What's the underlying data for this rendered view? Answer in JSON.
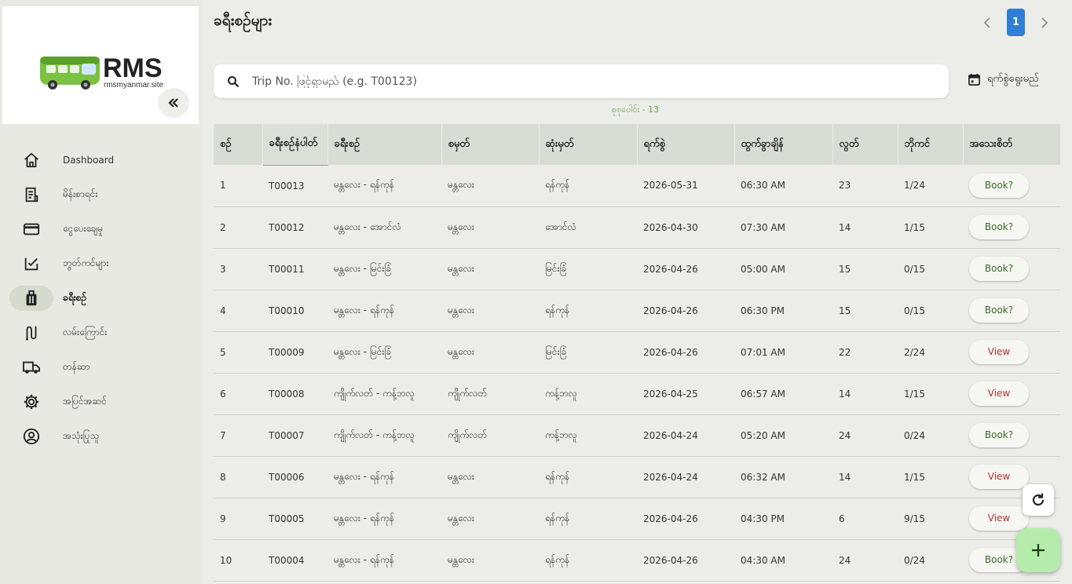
{
  "brand": {
    "logo_text": "RMS",
    "logo_subtext": "rmsmyanmar.site"
  },
  "sidebar": {
    "items": [
      {
        "label": "Dashboard",
        "icon": "home-icon"
      },
      {
        "label": "မိန်းစာရင်း",
        "icon": "receipt-icon"
      },
      {
        "label": "ငွေပေးချေမှု",
        "icon": "credit-card-icon"
      },
      {
        "label": "ဘွတ်ကင်များ",
        "icon": "checklist-icon"
      },
      {
        "label": "ခရီးစဉ်",
        "icon": "luggage-icon",
        "active": true
      },
      {
        "label": "လမ်းကြောင်း",
        "icon": "route-icon"
      },
      {
        "label": "တန်ဆာ",
        "icon": "truck-icon"
      },
      {
        "label": "အပြင်အဆင်",
        "icon": "gear-icon"
      },
      {
        "label": "အသုံးပြုသူ",
        "icon": "user-icon"
      }
    ]
  },
  "header": {
    "title": "ခရီးစဉ်များ"
  },
  "pagination": {
    "current": "1"
  },
  "search": {
    "placeholder": "Trip No. ဖြင့်ရှာမည် (e.g. T00123)",
    "value": ""
  },
  "date_filter": {
    "label": "ရက်စွဲရွေးမည်",
    "icon": "calendar-icon"
  },
  "summary": {
    "count_text": "စုစုပေါင်း - 13"
  },
  "colors": {
    "accent": "#2f7fd6",
    "fab": "#b5ecab",
    "book_text": "#3a6b2a",
    "view_text": "#b63232"
  },
  "table": {
    "columns": [
      "စဉ်",
      "ခရီးစဉ်နံပါတ်",
      "ခရီးစဉ်",
      "စမှတ်",
      "ဆုံးမှတ်",
      "ရက်စွဲ",
      "ထွက်ခွာချိန်",
      "လွတ်",
      "ဘိုကင်",
      "အသေးစိတ်"
    ],
    "rows": [
      [
        "1",
        "T00013",
        "မန္တလေး - ရန်ကုန်",
        "မန္တလေး",
        "ရန်ကုန်",
        "2026-05-31",
        "06:30 AM",
        "23",
        "1/24",
        "Book?"
      ],
      [
        "2",
        "T00012",
        "မန္တလေး - အောင်လံ",
        "မန္တလေး",
        "အောင်လံ",
        "2026-04-30",
        "07:30 AM",
        "14",
        "1/15",
        "Book?"
      ],
      [
        "3",
        "T00011",
        "မန္တလေး - မြင်းခြံ",
        "မန္တလေး",
        "မြင်းခြံ",
        "2026-04-26",
        "05:00 AM",
        "15",
        "0/15",
        "Book?"
      ],
      [
        "4",
        "T00010",
        "မန္တလေး - ရန်ကုန်",
        "မန္တလေး",
        "ရန်ကုန်",
        "2026-04-26",
        "06:30 PM",
        "15",
        "0/15",
        "Book?"
      ],
      [
        "5",
        "T00009",
        "မန္တလေး - မြင်းခြံ",
        "မန္တလေး",
        "မြင်းခြံ",
        "2026-04-26",
        "07:01 AM",
        "22",
        "2/24",
        "View"
      ],
      [
        "6",
        "T00008",
        "ကျိုက်လတ် - ကန့်ဘလူ",
        "ကျိုက်လတ်",
        "ကန့်ဘလူ",
        "2026-04-25",
        "06:57 AM",
        "14",
        "1/15",
        "View"
      ],
      [
        "7",
        "T00007",
        "ကျိုက်လတ် - ကန့်ဘလူ",
        "ကျိုက်လတ်",
        "ကန့်ဘလူ",
        "2026-04-24",
        "05:20 AM",
        "24",
        "0/24",
        "Book?"
      ],
      [
        "8",
        "T00006",
        "မန္တလေး - ရန်ကုန်",
        "မန္တလေး",
        "ရန်ကုန်",
        "2026-04-24",
        "06:32 AM",
        "14",
        "1/15",
        "View"
      ],
      [
        "9",
        "T00005",
        "မန္တလေး - ရန်ကုန်",
        "မန္တလေး",
        "ရန်ကုန်",
        "2026-04-26",
        "04:30 PM",
        "6",
        "9/15",
        "View"
      ],
      [
        "10",
        "T00004",
        "မန္တလေး - ရန်ကုန်",
        "မန္တလေး",
        "ရန်ကုန်",
        "2026-04-26",
        "04:30 AM",
        "24",
        "0/24",
        "Book?"
      ]
    ]
  },
  "fab": {
    "refresh_icon": "refresh-icon",
    "add_icon": "plus-icon"
  }
}
